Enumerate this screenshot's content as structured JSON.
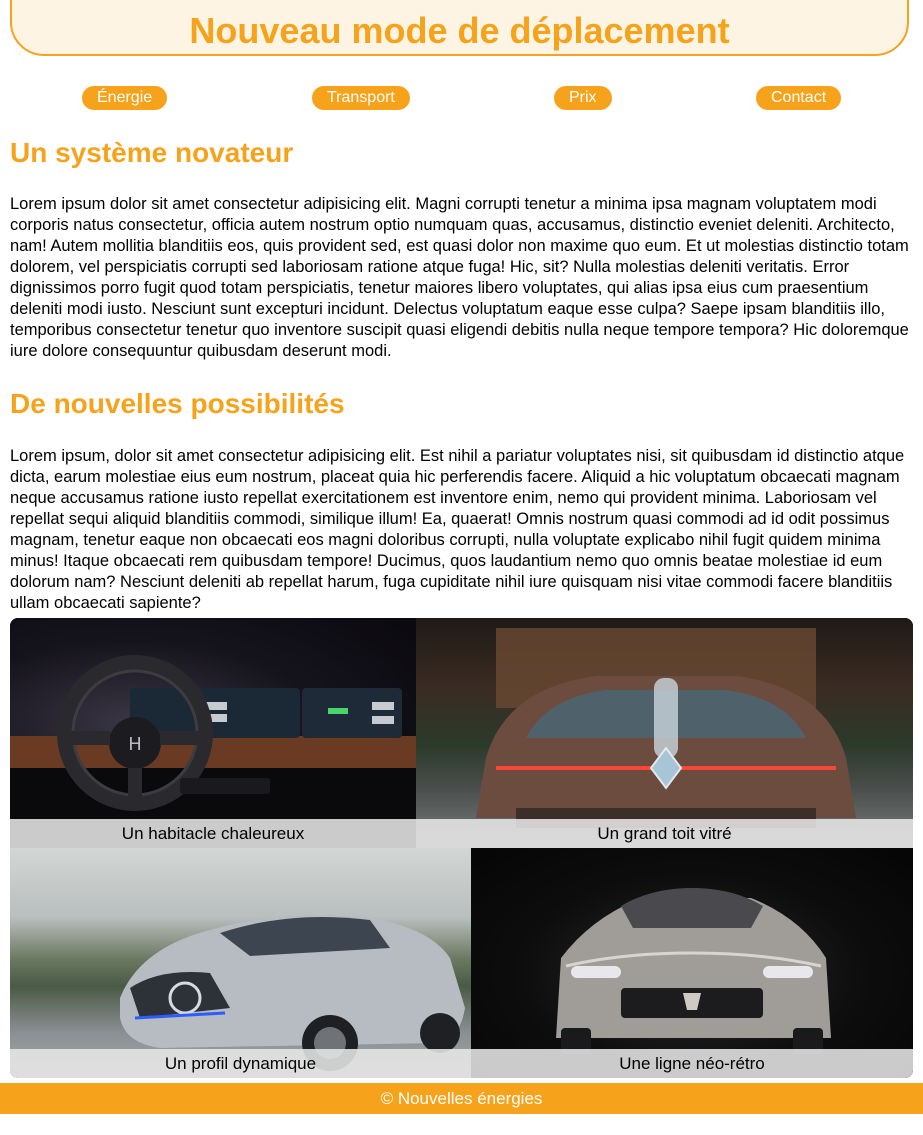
{
  "header": {
    "title": "Nouveau mode de déplacement"
  },
  "nav": {
    "items": [
      "Énergie",
      "Transport",
      "Prix",
      "Contact"
    ]
  },
  "sections": [
    {
      "title": "Un système novateur",
      "text": "Lorem ipsum dolor sit amet consectetur adipisicing elit. Magni corrupti tenetur a minima ipsa magnam voluptatem modi corporis natus consectetur, officia autem nostrum optio numquam quas, accusamus, distinctio eveniet deleniti. Architecto, nam! Autem mollitia blanditiis eos, quis provident sed, est quasi dolor non maxime quo eum. Et ut molestias distinctio totam dolorem, vel perspiciatis corrupti sed laboriosam ratione atque fuga! Hic, sit? Nulla molestias deleniti veritatis. Error dignissimos porro fugit quod totam perspiciatis, tenetur maiores libero voluptates, qui alias ipsa eius cum praesentium deleniti modi iusto. Nesciunt sunt excepturi incidunt. Delectus voluptatum eaque esse culpa? Saepe ipsam blanditiis illo, temporibus consectetur tenetur quo inventore suscipit quasi eligendi debitis nulla neque tempore tempora? Hic doloremque iure dolore consequuntur quibusdam deserunt modi."
    },
    {
      "title": "De nouvelles possibilités",
      "text": "Lorem ipsum, dolor sit amet consectetur adipisicing elit. Est nihil a pariatur voluptates nisi, sit quibusdam id distinctio atque dicta, earum molestiae eius eum nostrum, placeat quia hic perferendis facere. Aliquid a hic voluptatum obcaecati magnam neque accusamus ratione iusto repellat exercitationem est inventore enim, nemo qui provident minima. Laboriosam vel repellat sequi aliquid blanditiis commodi, similique illum! Ea, quaerat! Omnis nostrum quasi commodi ad id odit possimus magnam, tenetur eaque non obcaecati eos magni doloribus corrupti, nulla voluptate explicabo nihil fugit quidem minima minus! Itaque obcaecati rem quibusdam tempore! Ducimus, quos laudantium nemo quo omnis beatae molestiae id eum dolorum nam? Nesciunt deleniti ab repellat harum, fuga cupiditate nihil iure quisquam nisi vitae commodi facere blanditiis ullam obcaecati sapiente?"
    }
  ],
  "gallery": {
    "items": [
      {
        "caption": "Un habitacle chaleureux",
        "image": "car-interior-dashboard"
      },
      {
        "caption": "Un grand toit vitré",
        "image": "concept-car-rear-glass-roof"
      },
      {
        "caption": "Un profil dynamique",
        "image": "silver-electric-hatchback"
      },
      {
        "caption": "Une ligne néo-rétro",
        "image": "silver-coupe-front"
      }
    ]
  },
  "footer": {
    "text": "© Nouvelles énergies"
  },
  "colors": {
    "accent": "#f7a21b",
    "header_bg": "#fdf4e3",
    "caption_bg": "#e6e6e6"
  }
}
